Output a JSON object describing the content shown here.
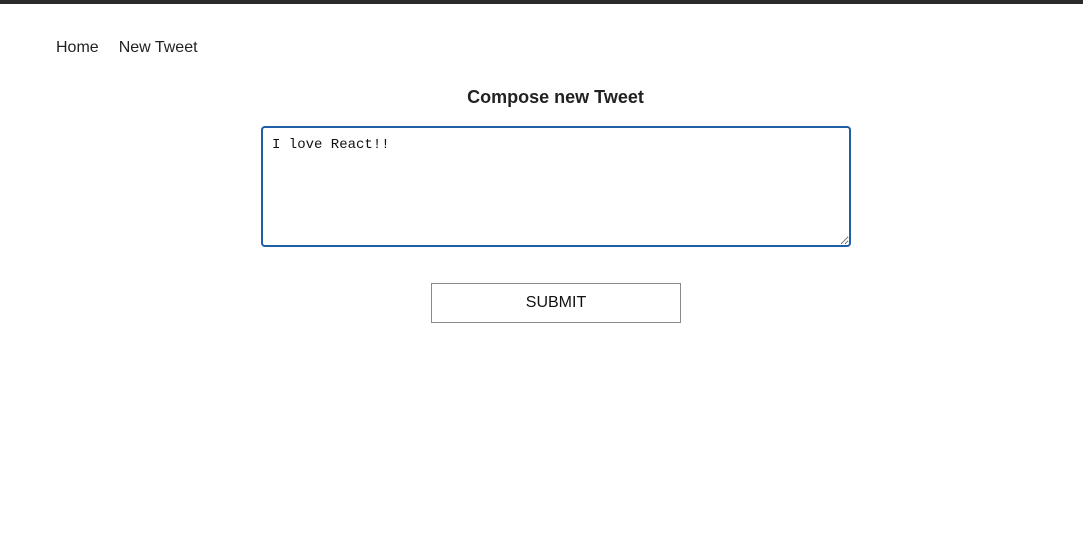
{
  "nav": {
    "items": [
      {
        "label": "Home"
      },
      {
        "label": "New Tweet"
      }
    ]
  },
  "compose": {
    "title": "Compose new Tweet",
    "input_value": "I love React!!",
    "submit_label": "SUBMIT"
  },
  "colors": {
    "top_bar": "#2b2b2b",
    "input_focus_border": "#1f5fa8"
  }
}
